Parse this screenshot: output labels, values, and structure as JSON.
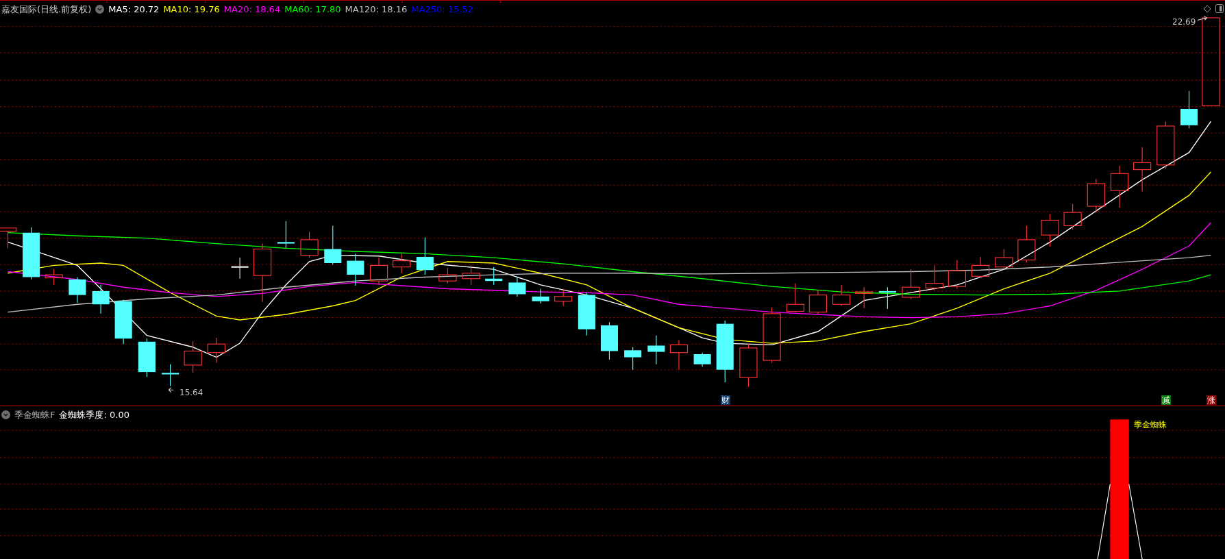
{
  "title": {
    "stock": "嘉友国际(日线.前复权)"
  },
  "moving_averages": [
    {
      "label": "MA5: 20.72",
      "color": "#ffffff"
    },
    {
      "label": "MA10: 19.76",
      "color": "#ffff00"
    },
    {
      "label": "MA20: 18.64",
      "color": "#ff00ff"
    },
    {
      "label": "MA60: 17.80",
      "color": "#00ff00"
    },
    {
      "label": "MA120: 18.16",
      "color": "#c0c0c0"
    },
    {
      "label": "MA250: 15.52",
      "color": "#0000ff"
    }
  ],
  "price_labels": {
    "high": "22.69",
    "low": "15.64"
  },
  "event_markers": [
    {
      "text": "财",
      "color": "#0a3a6a"
    },
    {
      "text": "减",
      "color": "#0a7a0a"
    },
    {
      "text": "涨",
      "color": "#8a0000"
    }
  ],
  "indicator": {
    "name": "季金蜘蛛F",
    "reading": "金蜘蛛季度: 0.00",
    "signal_label": "季金蜘蛛"
  }
}
